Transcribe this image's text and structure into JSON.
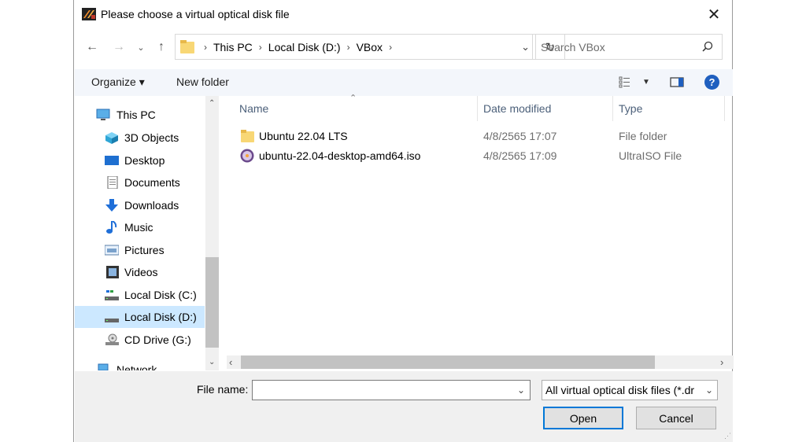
{
  "window": {
    "title": "Please choose a virtual optical disk file"
  },
  "address": {
    "crumbs": [
      "This PC",
      "Local Disk (D:)",
      "VBox"
    ]
  },
  "search": {
    "placeholder": "Search VBox"
  },
  "toolbar": {
    "organize": "Organize ▾",
    "new_folder": "New folder"
  },
  "nav": {
    "items": [
      {
        "label": "This PC",
        "icon": "computer-icon"
      },
      {
        "label": "3D Objects",
        "icon": "cube-icon"
      },
      {
        "label": "Desktop",
        "icon": "desktop-icon"
      },
      {
        "label": "Documents",
        "icon": "document-icon"
      },
      {
        "label": "Downloads",
        "icon": "download-icon"
      },
      {
        "label": "Music",
        "icon": "music-icon"
      },
      {
        "label": "Pictures",
        "icon": "picture-icon"
      },
      {
        "label": "Videos",
        "icon": "video-icon"
      },
      {
        "label": "Local Disk (C:)",
        "icon": "drive-icon"
      },
      {
        "label": "Local Disk (D:)",
        "icon": "drive-icon",
        "selected": true
      },
      {
        "label": "CD Drive (G:)",
        "icon": "cd-drive-icon"
      },
      {
        "label": "Network",
        "icon": "network-icon"
      }
    ]
  },
  "files": {
    "columns": [
      "Name",
      "Date modified",
      "Type"
    ],
    "rows": [
      {
        "name": "Ubuntu 22.04 LTS",
        "date": "4/8/2565 17:07",
        "type": "File folder",
        "icon": "folder-icon"
      },
      {
        "name": "ubuntu-22.04-desktop-amd64.iso",
        "date": "4/8/2565 17:09",
        "type": "UltraISO File",
        "icon": "iso-icon"
      }
    ]
  },
  "bottom": {
    "file_name_label": "File name:",
    "file_name_value": "",
    "filter": "All virtual optical disk files (*.dr",
    "open": "Open",
    "cancel": "Cancel"
  },
  "colors": {
    "accent": "#0078d7",
    "selection": "#cce8ff"
  }
}
